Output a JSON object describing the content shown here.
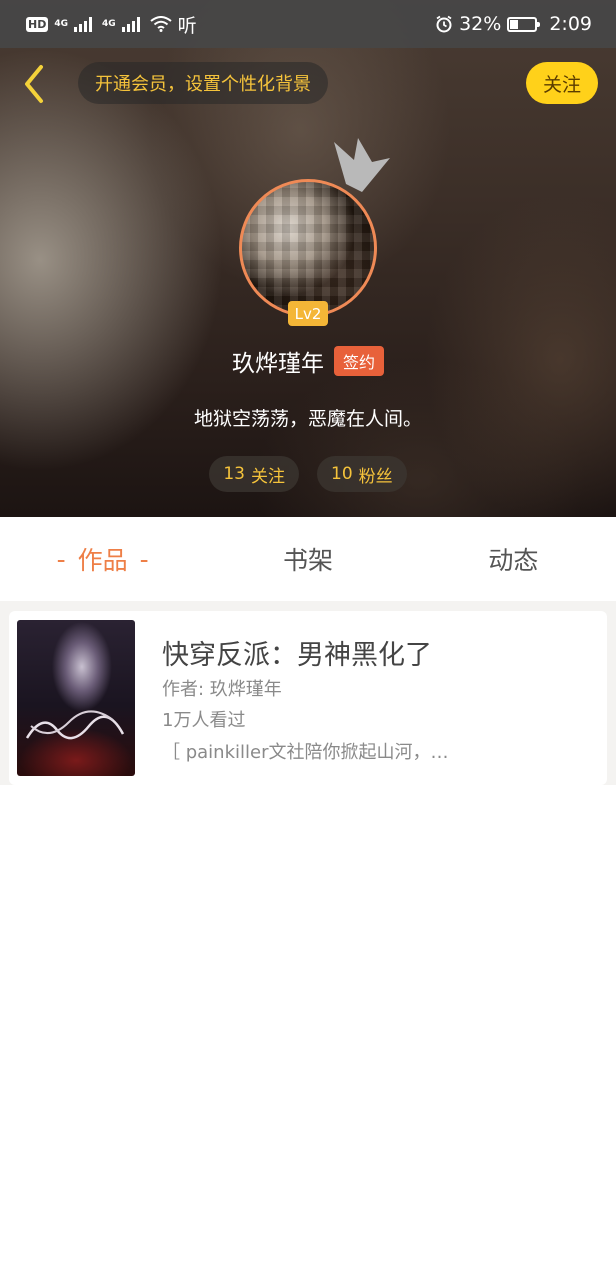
{
  "status_bar": {
    "hd_badge": "HD",
    "network_1": "4G",
    "network_2": "4G",
    "listen_label": "听",
    "battery_percent": "32%",
    "time": "2:09"
  },
  "header": {
    "vip_prompt": "开通会员，设置个性化背景",
    "follow_label": "关注"
  },
  "profile": {
    "level": "Lv2",
    "username": "玖烨瑾年",
    "signed_label": "签约",
    "bio": "地狱空荡荡，恶魔在人间。",
    "following_count": "13",
    "following_label": "关注",
    "fans_count": "10",
    "fans_label": "粉丝"
  },
  "tabs": [
    {
      "label": "作品",
      "active": true
    },
    {
      "label": "书架",
      "active": false
    },
    {
      "label": "动态",
      "active": false
    }
  ],
  "works": [
    {
      "title": "快穿反派：男神黑化了",
      "author": "作者: 玖烨瑾年",
      "views": "1万人看过",
      "description": "［ painkiller文社陪你掀起山河，…"
    }
  ],
  "colors": {
    "accent_orange": "#ee7f47",
    "follow_yellow": "#ffd11a",
    "gold_text": "#f5c33b",
    "signed_red": "#e8613a"
  },
  "icons": {
    "back": "chevron-left-icon",
    "alarm": "alarm-icon",
    "wifi": "wifi-icon",
    "battery": "battery-charging-icon",
    "crown": "crown-icon"
  }
}
